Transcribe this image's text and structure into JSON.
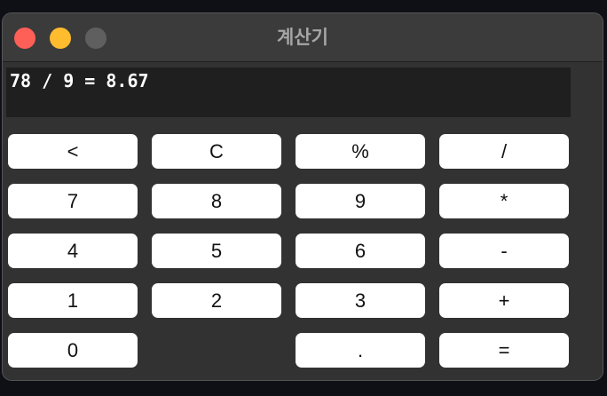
{
  "window": {
    "title": "계산기",
    "colors": {
      "close": "#fe5f57",
      "minimize": "#febc2e",
      "zoom": "#5f5f5f"
    }
  },
  "display": {
    "text": "78 / 9 = 8.67"
  },
  "keys": [
    {
      "id": "backspace",
      "label": "<",
      "row": 0,
      "col": 0
    },
    {
      "id": "clear",
      "label": "C",
      "row": 0,
      "col": 1
    },
    {
      "id": "percent",
      "label": "%",
      "row": 0,
      "col": 2
    },
    {
      "id": "divide",
      "label": "/",
      "row": 0,
      "col": 3
    },
    {
      "id": "7",
      "label": "7",
      "row": 1,
      "col": 0
    },
    {
      "id": "8",
      "label": "8",
      "row": 1,
      "col": 1
    },
    {
      "id": "9",
      "label": "9",
      "row": 1,
      "col": 2
    },
    {
      "id": "multiply",
      "label": "*",
      "row": 1,
      "col": 3
    },
    {
      "id": "4",
      "label": "4",
      "row": 2,
      "col": 0
    },
    {
      "id": "5",
      "label": "5",
      "row": 2,
      "col": 1
    },
    {
      "id": "6",
      "label": "6",
      "row": 2,
      "col": 2
    },
    {
      "id": "subtract",
      "label": "-",
      "row": 2,
      "col": 3
    },
    {
      "id": "1",
      "label": "1",
      "row": 3,
      "col": 0
    },
    {
      "id": "2",
      "label": "2",
      "row": 3,
      "col": 1
    },
    {
      "id": "3",
      "label": "3",
      "row": 3,
      "col": 2
    },
    {
      "id": "add",
      "label": "+",
      "row": 3,
      "col": 3
    },
    {
      "id": "0",
      "label": "0",
      "row": 4,
      "col": 0
    },
    {
      "id": "decimal",
      "label": ".",
      "row": 4,
      "col": 2
    },
    {
      "id": "equals",
      "label": "=",
      "row": 4,
      "col": 3
    }
  ]
}
